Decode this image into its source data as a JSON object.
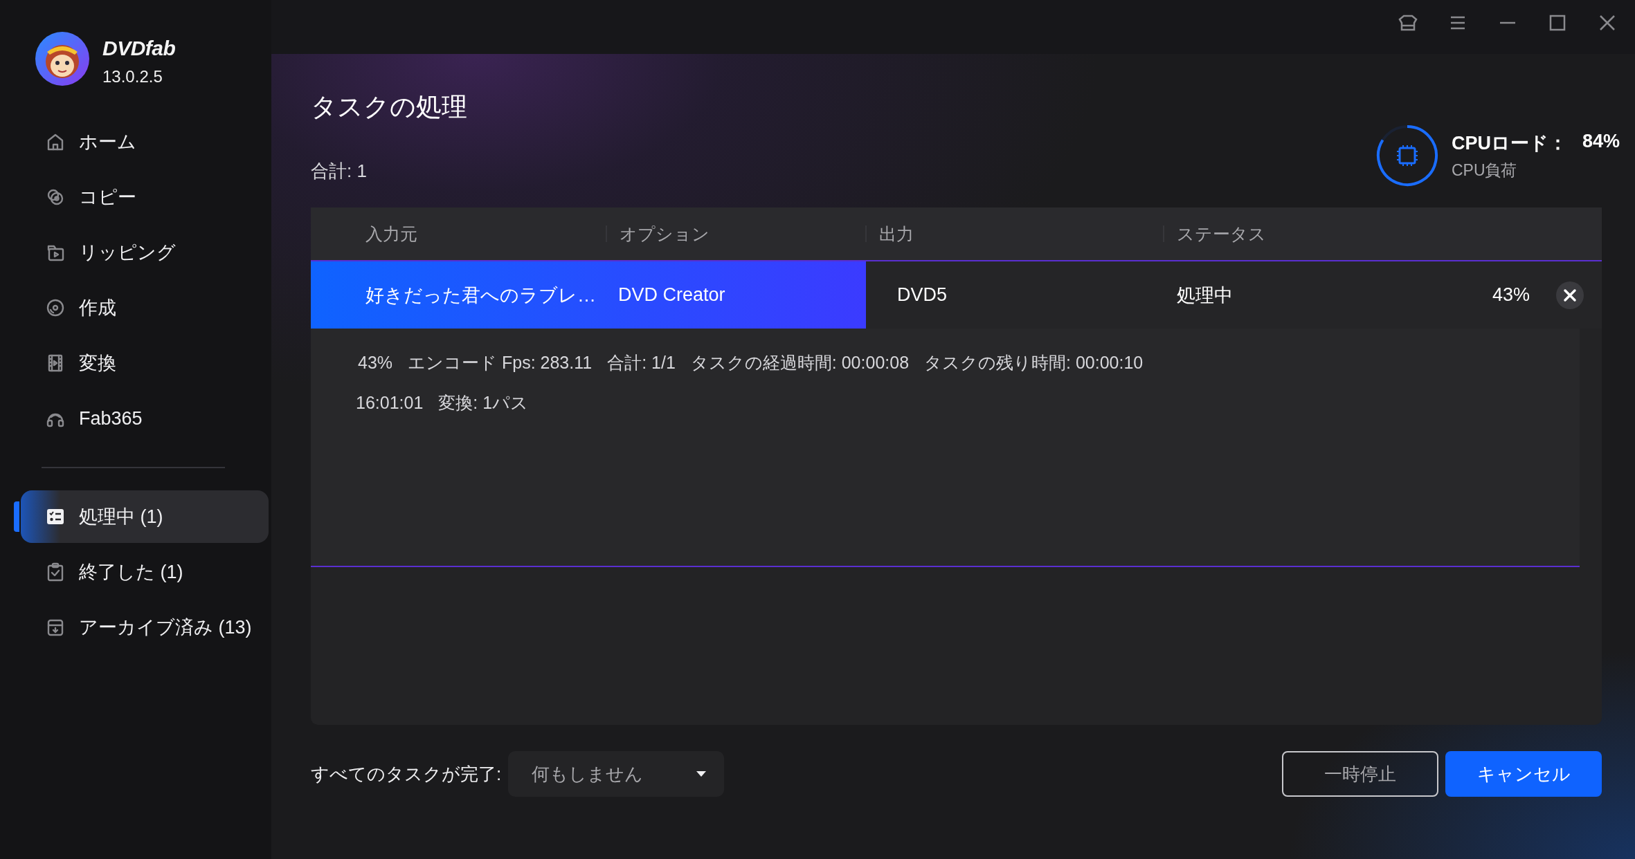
{
  "app": {
    "name": "DVDfab",
    "version": "13.0.2.5"
  },
  "sidebar": {
    "items": [
      {
        "label": "ホーム",
        "selected": false
      },
      {
        "label": "コピー",
        "selected": false
      },
      {
        "label": "リッピング",
        "selected": false
      },
      {
        "label": "作成",
        "selected": false
      },
      {
        "label": "変換",
        "selected": false
      },
      {
        "label": "Fab365",
        "selected": false
      }
    ],
    "task_items": [
      {
        "label": "処理中 (1)",
        "selected": true
      },
      {
        "label": "終了した (1)",
        "selected": false
      },
      {
        "label": "アーカイブ済み (13)",
        "selected": false
      }
    ]
  },
  "page": {
    "title": "タスクの処理",
    "total": "合計: 1"
  },
  "cpu": {
    "label": "CPUロード：",
    "value": "84%",
    "sublabel": "CPU負荷"
  },
  "table": {
    "columns": [
      "入力元",
      "オプション",
      "出力",
      "ステータス"
    ],
    "rows": [
      {
        "source": "好きだった君へのラブレ…",
        "option": "DVD Creator",
        "output": "DVD5",
        "status": "処理中",
        "progress": "43%",
        "level": 0.43,
        "details": [
          [
            "43%",
            "エンコード Fps: 283.11",
            "合計: 1/1",
            "タスクの経過時間: 00:00:08",
            "タスクの残り時間: 00:00:10"
          ],
          [
            "16:01:01",
            "変換: 1パス"
          ]
        ]
      }
    ]
  },
  "completion": {
    "label": "すべてのタスクが完了:",
    "value": "何もしません"
  },
  "buttons": [
    {
      "label": "一時停止",
      "kind": "outline"
    },
    {
      "label": "キャンセル",
      "kind": "primary"
    }
  ]
}
